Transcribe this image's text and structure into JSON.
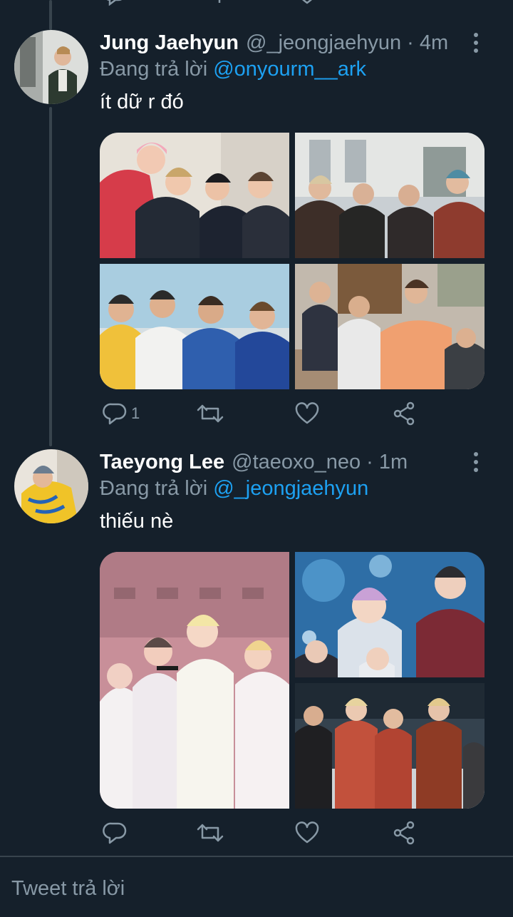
{
  "tweets": [
    {
      "name": "Jung Jaehyun",
      "handle": "@_jeongjaehyun",
      "time": "· 4m",
      "reply_prefix": "Đang trả lời",
      "reply_to": "@onyourm__ark",
      "text": "ít dữ r đó",
      "reply_count": "1",
      "photos": [
        "photo 1",
        "photo 2",
        "photo 3",
        "photo 4"
      ]
    },
    {
      "name": "Taeyong Lee",
      "handle": "@taeoxo_neo",
      "time": "· 1m",
      "reply_prefix": "Đang trả lời",
      "reply_to": "@_jeongjaehyun",
      "text": "thiếu nè",
      "reply_count": "",
      "photos": [
        "photo 1",
        "photo 2",
        "photo 3"
      ]
    }
  ],
  "compose": {
    "placeholder": "Tweet trả lời"
  },
  "icons": {
    "reply": "reply-icon",
    "retweet": "retweet-icon",
    "like": "heart-icon",
    "share": "share-icon",
    "more": "more-vertical-icon"
  },
  "colors": {
    "background": "#15202b",
    "secondary_text": "#8899a6",
    "link": "#1da1f2",
    "divider": "#38444d"
  }
}
